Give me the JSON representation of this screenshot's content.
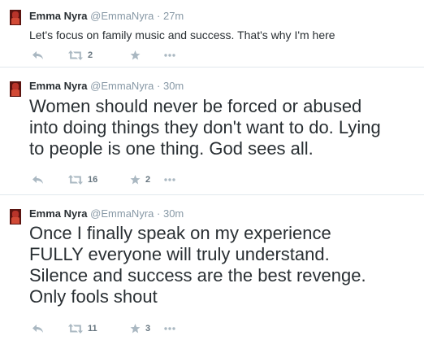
{
  "tweets": [
    {
      "name": "Emma Nyra",
      "handle": "@EmmaNyra",
      "separator": "·",
      "time": "27m",
      "text": "Let's focus on family music and success. That's why I'm here",
      "retweets": "2",
      "favorites": ""
    },
    {
      "name": "Emma Nyra",
      "handle": "@EmmaNyra",
      "separator": "·",
      "time": "30m",
      "text": "Women should never be forced or abused\ninto doing things they don't want to do. Lying\nto people is one thing.  God sees all.",
      "retweets": "16",
      "favorites": "2"
    },
    {
      "name": "Emma Nyra",
      "handle": "@EmmaNyra",
      "separator": "·",
      "time": "30m",
      "text": "Once I finally speak on my experience\nFULLY everyone will truly understand.\nSilence and success are the best revenge.\nOnly fools shout",
      "retweets": "11",
      "favorites": "3"
    }
  ],
  "icons": {
    "reply": "reply-icon",
    "retweet": "retweet-icon",
    "favorite": "star-icon",
    "more": "more-dots-icon"
  },
  "colors": {
    "name": "#292f33",
    "meta": "#8899a6",
    "icon": "#aab8c2",
    "divider": "#e1e8ed"
  }
}
